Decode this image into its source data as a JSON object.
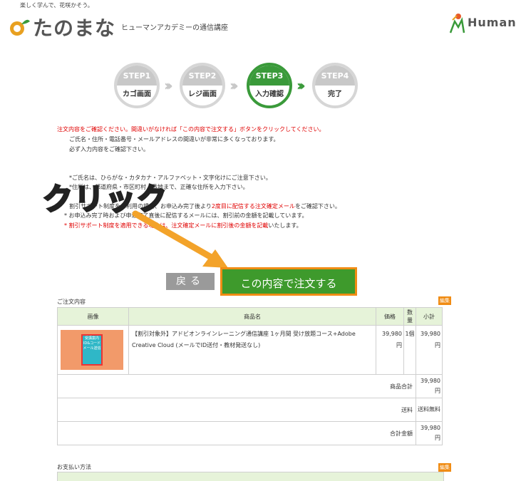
{
  "header": {
    "tagline": "楽しく学んで、花咲かそう。",
    "logo_text": "たのまな",
    "logo_sub": "ヒューマンアカデミーの通信講座",
    "human_text": "Human"
  },
  "steps": [
    {
      "num": "STEP1",
      "label": "カゴ画面",
      "active": false
    },
    {
      "num": "STEP2",
      "label": "レジ画面",
      "active": false
    },
    {
      "num": "STEP3",
      "label": "入力確認",
      "active": true
    },
    {
      "num": "STEP4",
      "label": "完了",
      "active": false
    }
  ],
  "notice": {
    "line1": "注文内容をご確認ください。間違いがなければ「この内容で注文する」ボタンをクリックしてください。",
    "line2": "ご氏名・住所・電話番号・メールアドレスの間違いが非常に多くなっております。",
    "line3": "必ず入力内容をご確認下さい。",
    "line4": "*ご氏名は、ひらがな・カタカナ・アルファベット・文字化けにご注意下さい。",
    "line5": "*住所は、都道府県・市区町村・番地まで、正確な住所を入力下さい。",
    "line6a": "割引サポート制度をご利用の場合、お申込み完了後より",
    "line6b": "2度目に配信する注文確定メール",
    "line6c": "をご確認下さい。",
    "line7": "* お申込み完了時および申込完了直後に配信するメールには、割引前の金額を記載しています。",
    "line8a": "* 割引サポート制度を適用できる場合は、",
    "line8b": "注文確定メールに割引後の金額を記載",
    "line8c": "いたします。"
  },
  "annotation": {
    "click_label": "クリック"
  },
  "buttons": {
    "back": "戻る",
    "order": "この内容で注文する"
  },
  "order_section": {
    "title": "ご注文内容",
    "edit": "編集",
    "columns": [
      "画像",
      "商品名",
      "価格",
      "数量",
      "小計"
    ],
    "item": {
      "name": "【割引対象外】アドビオンラインレーニング通信講座 1ヶ月間 受け放題コース+Adobe Creative Cloud (メールでID送付・教材発送なし)",
      "price": "39,980円",
      "qty": "1個",
      "subtotal": "39,980円",
      "thumb_text": "受講案内 ID&コード メール送信"
    },
    "summary": [
      {
        "label": "商品合計",
        "value": "39,980円"
      },
      {
        "label": "送料",
        "value": "送料無料"
      },
      {
        "label": "合計金額",
        "value": "39,980円"
      }
    ]
  },
  "payment_section": {
    "title": "お支払い方法",
    "edit": "編集"
  },
  "colors": {
    "accent_green": "#3e9a2c",
    "annotation_orange": "#f08c14",
    "notice_red": "#e00000"
  }
}
